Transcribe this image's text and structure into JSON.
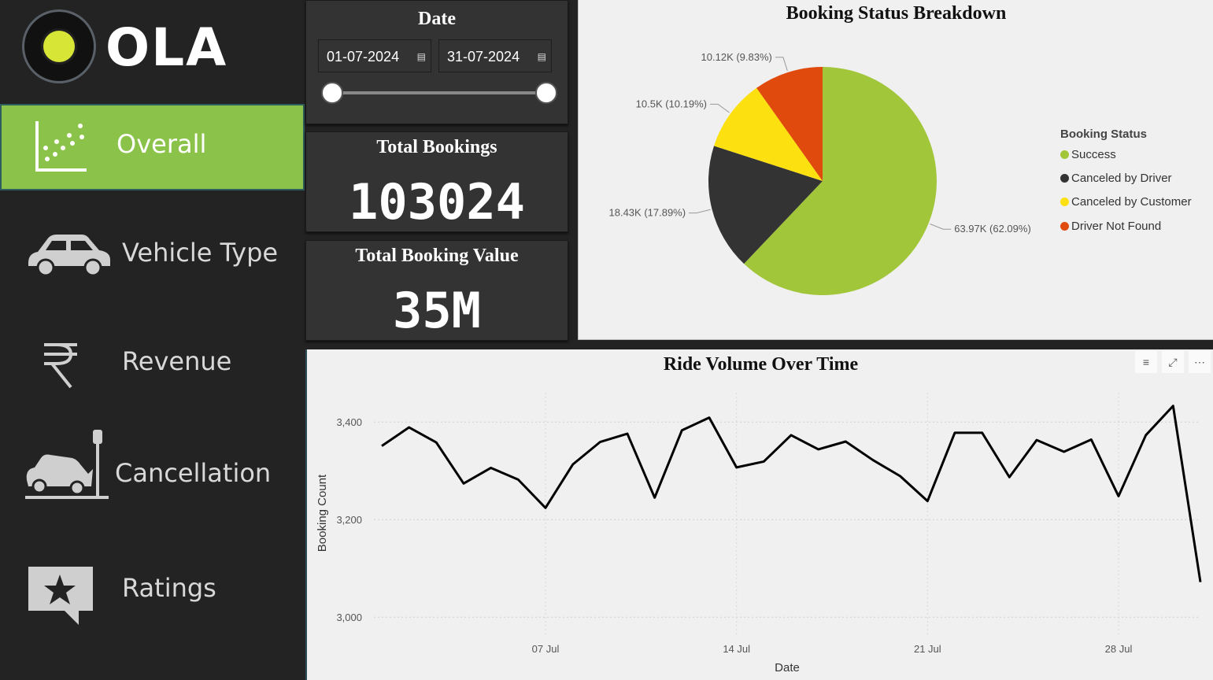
{
  "brand": {
    "name": "OLA"
  },
  "nav": [
    {
      "label": "Overall",
      "icon": "scatter-chart-icon",
      "active": true
    },
    {
      "label": "Vehicle Type",
      "icon": "car-icon",
      "active": false
    },
    {
      "label": "Revenue",
      "icon": "rupee-icon",
      "active": false
    },
    {
      "label": "Cancellation",
      "icon": "car-crash-icon",
      "active": false
    },
    {
      "label": "Ratings",
      "icon": "star-chat-icon",
      "active": false
    }
  ],
  "date_filter": {
    "title": "Date",
    "start": "01-07-2024",
    "end": "31-07-2024",
    "range_selected": [
      0,
      1
    ]
  },
  "kpis": {
    "total_bookings": {
      "title": "Total Bookings",
      "value": "103024"
    },
    "total_booking_value": {
      "title": "Total Booking Value",
      "value": "35M"
    }
  },
  "colors": {
    "accent": "#8bc34a",
    "success": "#a2c63a",
    "canceled_driver": "#333333",
    "canceled_customer": "#fde00f",
    "not_found": "#e04a0c"
  },
  "chart_data": [
    {
      "type": "pie",
      "title": "Booking Status Breakdown",
      "legend_title": "Booking Status",
      "legend_position": "right",
      "slices": [
        {
          "name": "Success",
          "value": 63970,
          "label": "63.97K (62.09%)",
          "color": "#a2c63a"
        },
        {
          "name": "Canceled by Driver",
          "value": 18430,
          "label": "18.43K (17.89%)",
          "color": "#333333"
        },
        {
          "name": "Canceled by Customer",
          "value": 10500,
          "label": "10.5K (10.19%)",
          "color": "#fde00f"
        },
        {
          "name": "Driver Not Found",
          "value": 10120,
          "label": "10.12K (9.83%)",
          "color": "#e04a0c"
        }
      ]
    },
    {
      "type": "line",
      "title": "Ride Volume Over Time",
      "xlabel": "Date",
      "ylabel": "Booking Count",
      "ylim": [
        3000,
        3500
      ],
      "yticks": [
        3000,
        3200,
        3400
      ],
      "ytick_labels": [
        "3,000",
        "3,200",
        "3,400"
      ],
      "xticks": [
        "07 Jul",
        "14 Jul",
        "21 Jul",
        "28 Jul"
      ],
      "grid": true,
      "x": [
        "2024-07-01",
        "2024-07-02",
        "2024-07-03",
        "2024-07-04",
        "2024-07-05",
        "2024-07-06",
        "2024-07-07",
        "2024-07-08",
        "2024-07-09",
        "2024-07-10",
        "2024-07-11",
        "2024-07-12",
        "2024-07-13",
        "2024-07-14",
        "2024-07-15",
        "2024-07-16",
        "2024-07-17",
        "2024-07-18",
        "2024-07-19",
        "2024-07-20",
        "2024-07-21",
        "2024-07-22",
        "2024-07-23",
        "2024-07-24",
        "2024-07-25",
        "2024-07-26",
        "2024-07-27",
        "2024-07-28",
        "2024-07-29",
        "2024-07-30",
        "2024-07-31"
      ],
      "y": [
        3351,
        3389,
        3358,
        3274,
        3306,
        3282,
        3224,
        3313,
        3359,
        3376,
        3245,
        3383,
        3409,
        3307,
        3319,
        3373,
        3344,
        3360,
        3322,
        3289,
        3238,
        3378,
        3378,
        3287,
        3363,
        3339,
        3364,
        3248,
        3373,
        3433,
        3072
      ]
    }
  ],
  "toolbar": {
    "filter_icon": "filter-icon",
    "focus_icon": "focus-mode-icon",
    "more_icon": "more-options-icon"
  }
}
